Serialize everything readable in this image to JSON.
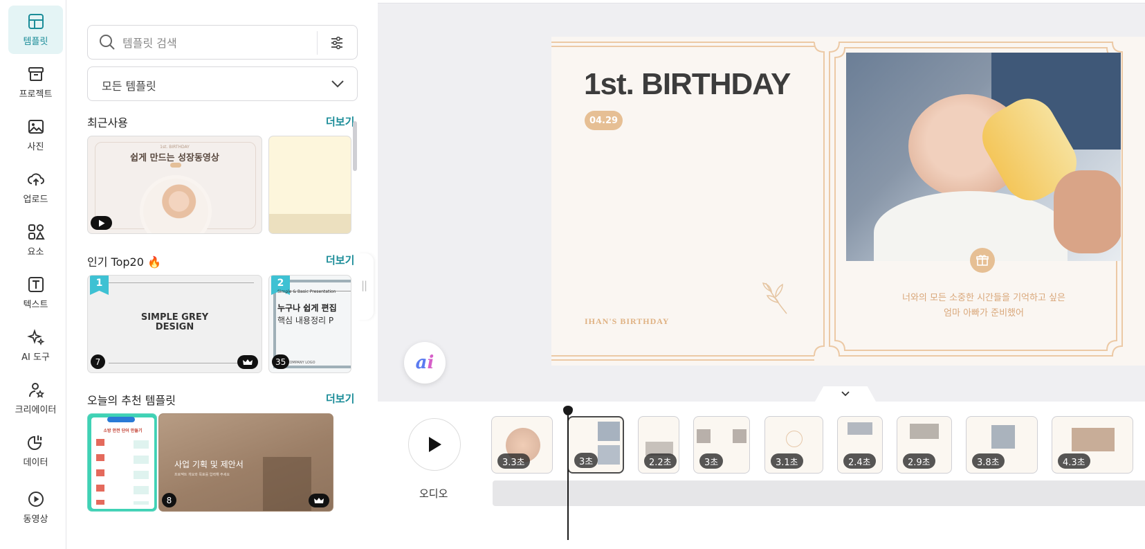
{
  "rail": {
    "items": [
      {
        "label": "템플릿",
        "icon": "template-icon",
        "active": true
      },
      {
        "label": "프로젝트",
        "icon": "archive-box-icon"
      },
      {
        "label": "사진",
        "icon": "image-icon"
      },
      {
        "label": "업로드",
        "icon": "cloud-upload-icon"
      },
      {
        "label": "요소",
        "icon": "shapes-icon"
      },
      {
        "label": "텍스트",
        "icon": "text-t-icon"
      },
      {
        "label": "AI 도구",
        "icon": "sparkles-icon"
      },
      {
        "label": "크리에이터",
        "icon": "creator-star-user-icon"
      },
      {
        "label": "데이터",
        "icon": "chart-pie-bars-icon"
      },
      {
        "label": "동영상",
        "icon": "play-circle-icon"
      }
    ]
  },
  "panel": {
    "search": {
      "placeholder": "템플릿 검색"
    },
    "category": {
      "value": "모든 템플릿"
    },
    "recent": {
      "title": "최근사용",
      "more": "더보기",
      "card1": {
        "title": "쉽게 만드는 성장동영상",
        "kicker": "1st. BIRTHDAY"
      }
    },
    "popular": {
      "title": "인기 Top20",
      "emoji": "🔥",
      "more": "더보기",
      "card1": {
        "rank": "1",
        "title_line1": "SIMPLE GREY",
        "title_line2": "DESIGN",
        "count": "7"
      },
      "card2": {
        "rank": "2",
        "tag": "Simple & Basic Presentation",
        "line1": "누구나 쉽게 편집",
        "line2": "핵심 내용정리 P",
        "logo": "COMPANY LOGO",
        "count": "35"
      }
    },
    "recommended": {
      "title": "오늘의 추천 템플릿",
      "more": "더보기",
      "card1": {
        "title": "소방 안전 단어 만들기"
      },
      "card2": {
        "title": "사업 기획 및 제안서",
        "sub": "프로젝트 개요와 목표를 입력해 주세요",
        "count": "8"
      }
    }
  },
  "slide": {
    "title": "1st. BIRTHDAY",
    "date": "04.29",
    "name": "IHAN'S  BIRTHDAY",
    "message_line1": "너와의 모든 소중한 시간들을 기억하고 싶은",
    "message_line2": "엄마 아빠가 준비했어",
    "colors": {
      "accent": "#e6bf94",
      "frame": "#ecc9a5",
      "background": "#faf6f2"
    }
  },
  "ai_button": {
    "a": "a",
    "i": "i"
  },
  "timeline": {
    "audio_label": "오디오",
    "clips": [
      {
        "duration": "3.3초"
      },
      {
        "duration": "3초",
        "selected": true
      },
      {
        "duration": "2.2초"
      },
      {
        "duration": "3초"
      },
      {
        "duration": "3.1초"
      },
      {
        "duration": "2.4초"
      },
      {
        "duration": "2.9초"
      },
      {
        "duration": "3.8초"
      },
      {
        "duration": "4.3초"
      }
    ]
  }
}
